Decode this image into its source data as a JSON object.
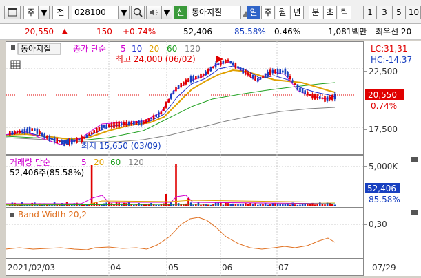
{
  "toolbar": {
    "market_label": "주",
    "mode_label": "전",
    "code_value": "028100",
    "sin_badge": "신",
    "stock_name": "동아지질",
    "periods": [
      "일",
      "주",
      "월",
      "년",
      "분",
      "초",
      "틱"
    ],
    "selected_period": "일",
    "intervals": [
      "1",
      "3",
      "5",
      "10"
    ]
  },
  "quote": {
    "price": "20,550",
    "change": "150",
    "change_pct": "+0.74%",
    "volume": "52,406",
    "vol_ratio": "85.58%",
    "turnover": "0.46%",
    "amount": "1,081백만",
    "extra": "최우선 20"
  },
  "chart": {
    "stock_tag": "동아지질",
    "ma_label": "종가 단순",
    "ma_periods": [
      "5",
      "10",
      "20",
      "60",
      "120"
    ],
    "ma_colors": [
      "#d000d0",
      "#2030d0",
      "#e0a000",
      "#20a020",
      "#808080"
    ],
    "high_note": "최고 24,000 (06/02)",
    "low_note": "최저 15,650 (03/09)",
    "lc": "LC:31,31",
    "hc": "HC:-14,37",
    "price_ticks": [
      "22,500",
      "17,500"
    ],
    "cur_price": "20,550",
    "cur_pct": "0.74%",
    "vol_label": "거래량 단순",
    "vol_periods": [
      "5",
      "20",
      "60",
      "120"
    ],
    "vol_colors": [
      "#d000d0",
      "#e0a000",
      "#20a020",
      "#808080"
    ],
    "vol_now": "52,406주(85.58%)",
    "vol_tick": "5,000K",
    "vol_cur": "52,406",
    "vol_cur_pct": "85.58%",
    "bw_label": "Band Width 20,2",
    "bw_tick": "0,30",
    "x_labels": [
      "2021/02/03",
      "04",
      "05",
      "06",
      "07"
    ],
    "x_end_label": "07/29",
    "colors": {
      "up": "#e00000",
      "down": "#1840c0",
      "accent": "#2f64c8"
    }
  }
}
